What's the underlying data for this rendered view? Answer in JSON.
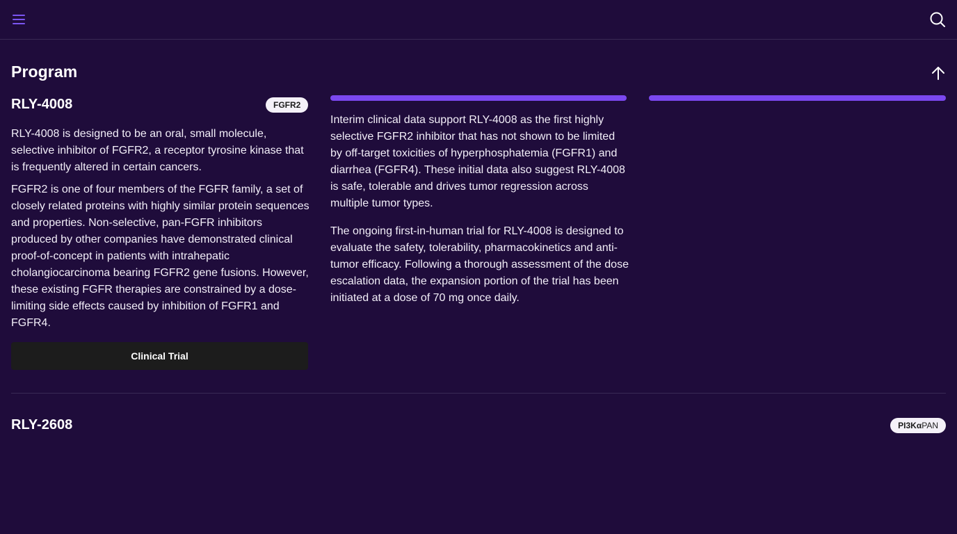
{
  "header": {
    "menu_icon": "hamburger-menu-icon",
    "search_icon": "search-icon",
    "accent_color": "#7b55f2"
  },
  "section": {
    "title": "Program",
    "up_icon": "arrow-up-icon"
  },
  "programs": [
    {
      "name": "RLY-4008",
      "badge": "FGFR2",
      "paragraphs_left": [
        "RLY-4008 is designed to be an oral, small molecule, selective inhibitor of FGFR2, a receptor tyrosine kinase that is frequently altered in certain cancers.",
        "FGFR2 is one of four members of the FGFR family, a set of closely related proteins with highly similar protein sequences and properties. Non-selective, pan-FGFR inhibitors produced by other companies have demonstrated clinical proof-of-concept in patients with intrahepatic cholangiocarcinoma bearing FGFR2 gene fusions. However, these existing FGFR therapies are constrained by a dose-limiting side effects caused by inhibition of FGFR1 and FGFR4."
      ],
      "paragraphs_right": [
        "Interim clinical data support RLY-4008 as the first highly selective FGFR2 inhibitor that has not shown to be limited by off-target toxicities of hyperphosphatemia (FGFR1) and diarrhea (FGFR4). These initial data also suggest RLY-4008 is safe, tolerable and drives tumor regression across multiple tumor types.",
        "The ongoing first-in-human trial for RLY-4008 is designed to evaluate the safety, tolerability, pharmacokinetics and anti-tumor efficacy. Following a thorough assessment of the dose escalation data, the expansion portion of the trial has been initiated at a dose of 70 mg once daily."
      ],
      "button": "Clinical Trial",
      "progress_bar_color": "#7b48ef"
    },
    {
      "name": "RLY-2608",
      "badge_bold": "PI3Kα",
      "badge_light": "PAN"
    }
  ]
}
